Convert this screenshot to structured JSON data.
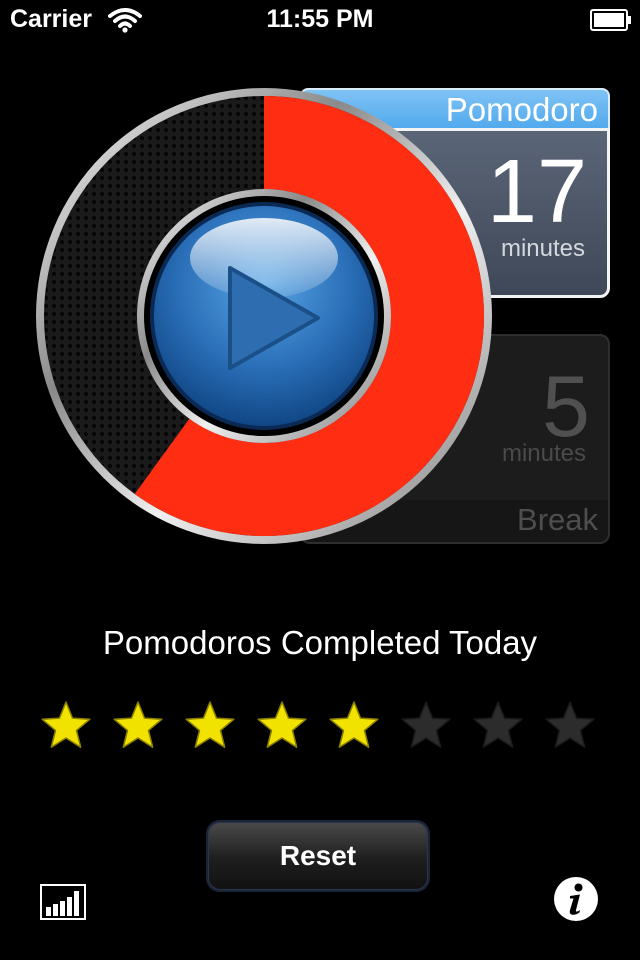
{
  "status_bar": {
    "carrier": "Carrier",
    "time": "11:55 PM",
    "wifi_icon": "wifi-icon",
    "battery_icon": "battery-icon"
  },
  "timer": {
    "work": {
      "label": "Pomodoro",
      "value": "17",
      "unit": "minutes",
      "active": true
    },
    "break": {
      "label": "Break",
      "value": "5",
      "unit": "minutes",
      "active": false
    },
    "remaining_fraction": 0.6,
    "play_icon": "play-icon"
  },
  "completed": {
    "title": "Pomodoros Completed Today",
    "completed_count": 5,
    "total_count": 8
  },
  "controls": {
    "reset_label": "Reset",
    "stats_icon": "bar-chart-icon",
    "info_icon": "info-icon"
  },
  "colors": {
    "progress": "#ff2e12",
    "active_tab": "#5ab0ef",
    "work_panel": "#4b5567",
    "star_on": "#f2e200",
    "star_off": "#2c2c2c",
    "background": "#000000"
  }
}
